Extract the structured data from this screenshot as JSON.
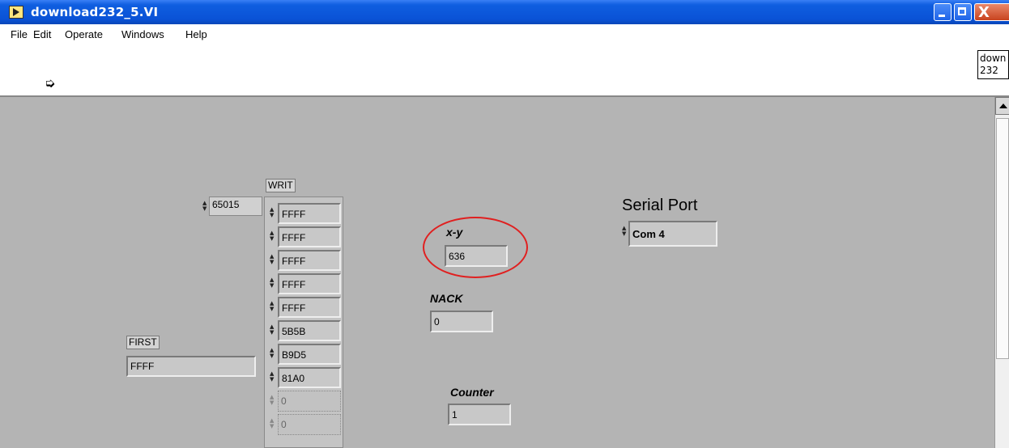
{
  "window": {
    "title": "download232_5.VI",
    "close_glyph": "X"
  },
  "menu": {
    "items": [
      "File",
      "Edit",
      "Operate",
      "Windows",
      "Help"
    ]
  },
  "toolbar": {
    "run_icon": "run-arrow-icon",
    "run_glyph": "➭"
  },
  "vi_icon": {
    "line1": "down",
    "line2": "232"
  },
  "controls": {
    "start_addr_value": "65015",
    "writ_label": "WRIT",
    "writ_values": [
      "FFFF",
      "FFFF",
      "FFFF",
      "FFFF",
      "FFFF",
      "5B5B",
      "B9D5",
      "81A0",
      "0",
      "0"
    ],
    "first_label": "FIRST",
    "first_value": "FFFF",
    "xy_label": "x-y",
    "xy_value": "636",
    "nack_label": "NACK",
    "nack_value": "0",
    "counter_label": "Counter",
    "counter_value": "1",
    "serial_label": "Serial Port",
    "serial_value": "Com 4"
  },
  "colors": {
    "titlebar": "#0a52d6",
    "panel": "#b4b4b4",
    "highlight": "#e02020"
  }
}
